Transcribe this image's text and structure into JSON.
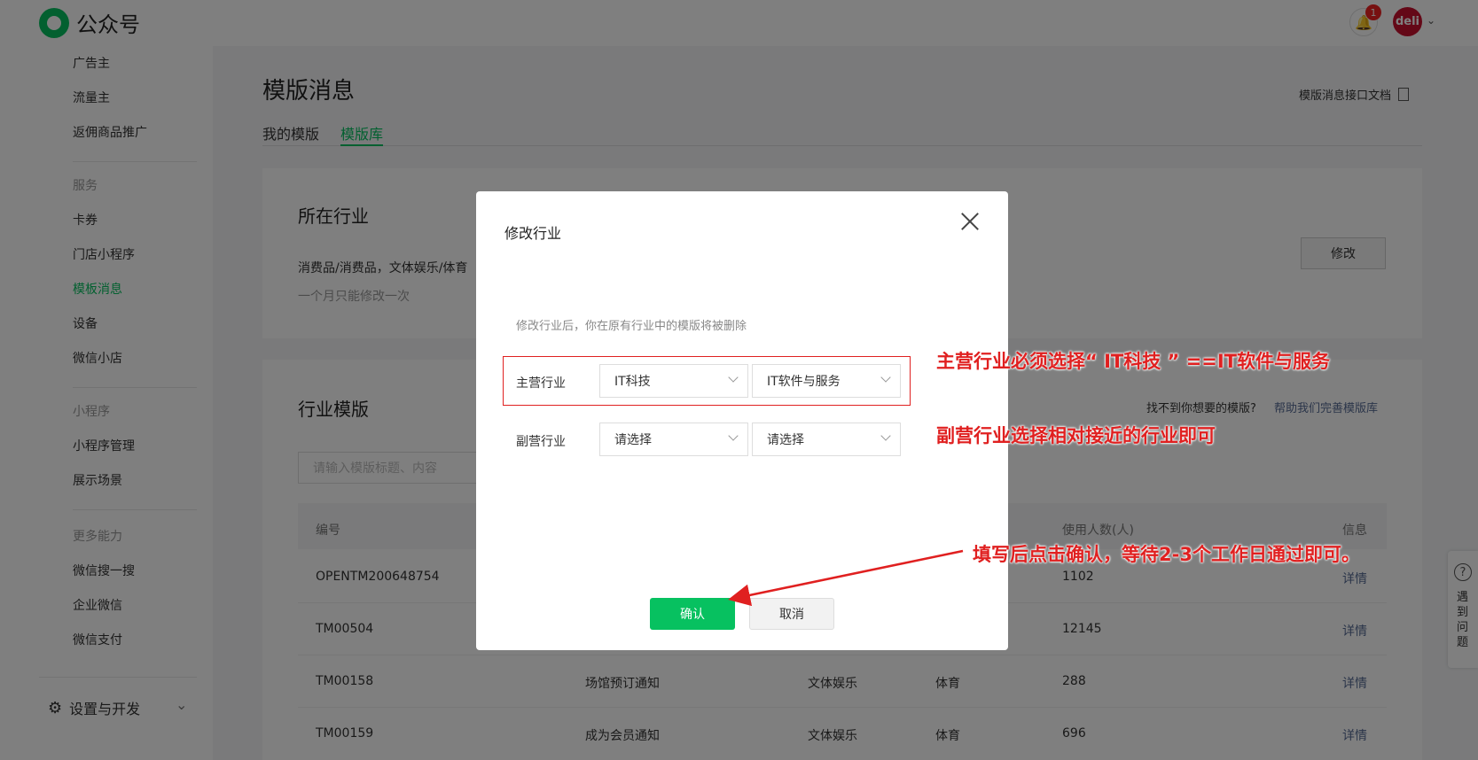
{
  "app": {
    "name": "公众号"
  },
  "header": {
    "notification_count": "1",
    "avatar_text": "deli"
  },
  "sidebar": {
    "items_top": [
      "广告主",
      "流量主",
      "返佣商品推广"
    ],
    "group_service": "服务",
    "service_items": [
      "卡券",
      "门店小程序",
      "模板消息",
      "设备",
      "微信小店"
    ],
    "group_miniprogram": "小程序",
    "miniprogram_items": [
      "小程序管理",
      "展示场景"
    ],
    "group_more": "更多能力",
    "more_items": [
      "微信搜一搜",
      "企业微信",
      "微信支付"
    ],
    "settings": "设置与开发"
  },
  "page": {
    "title": "模版消息",
    "doc_link": "模版消息接口文档",
    "tabs": [
      "我的模版",
      "模版库"
    ],
    "industry": {
      "title": "所在行业",
      "value": "消费品/消费品，文体娱乐/体育",
      "note": "一个月只能修改一次",
      "modify": "修改"
    },
    "templates": {
      "title": "行业模版",
      "no_find": "找不到你想要的模版?",
      "help_link": "帮助我们完善模版库",
      "search_placeholder": "请输入模版标题、内容",
      "columns": [
        "编号",
        "使用人数(人)",
        "信息"
      ],
      "rows": [
        {
          "id": "OPENTM200648754",
          "title": "",
          "primary": "",
          "secondary": "",
          "users": "1102",
          "action": "详情"
        },
        {
          "id": "TM00504",
          "title": "",
          "primary": "",
          "secondary": "",
          "users": "12145",
          "action": "详情"
        },
        {
          "id": "TM00158",
          "title": "场馆预订通知",
          "primary": "文体娱乐",
          "secondary": "体育",
          "users": "288",
          "action": "详情"
        },
        {
          "id": "TM00159",
          "title": "成为会员通知",
          "primary": "文体娱乐",
          "secondary": "体育",
          "users": "696",
          "action": "详情"
        }
      ]
    }
  },
  "help_float": {
    "text": "遇到问题"
  },
  "dialog": {
    "title": "修改行业",
    "warning": "修改行业后，你在原有行业中的模版将被删除",
    "primary_label": "主营行业",
    "primary_select_1": "IT科技",
    "primary_select_2": "IT软件与服务",
    "secondary_label": "副营行业",
    "secondary_select_1": "请选择",
    "secondary_select_2": "请选择",
    "ok": "确认",
    "cancel": "取消"
  },
  "annotations": {
    "note1": "主营行业必须选择“ IT科技 ” ==IT软件与服务",
    "note2": "副营行业选择相对接近的行业即可",
    "note3": "填写后点击确认，等待2-3个工作日通过即可。"
  },
  "colors": {
    "brand": "#07c160",
    "annotation": "#e02020",
    "link": "#576b95"
  }
}
